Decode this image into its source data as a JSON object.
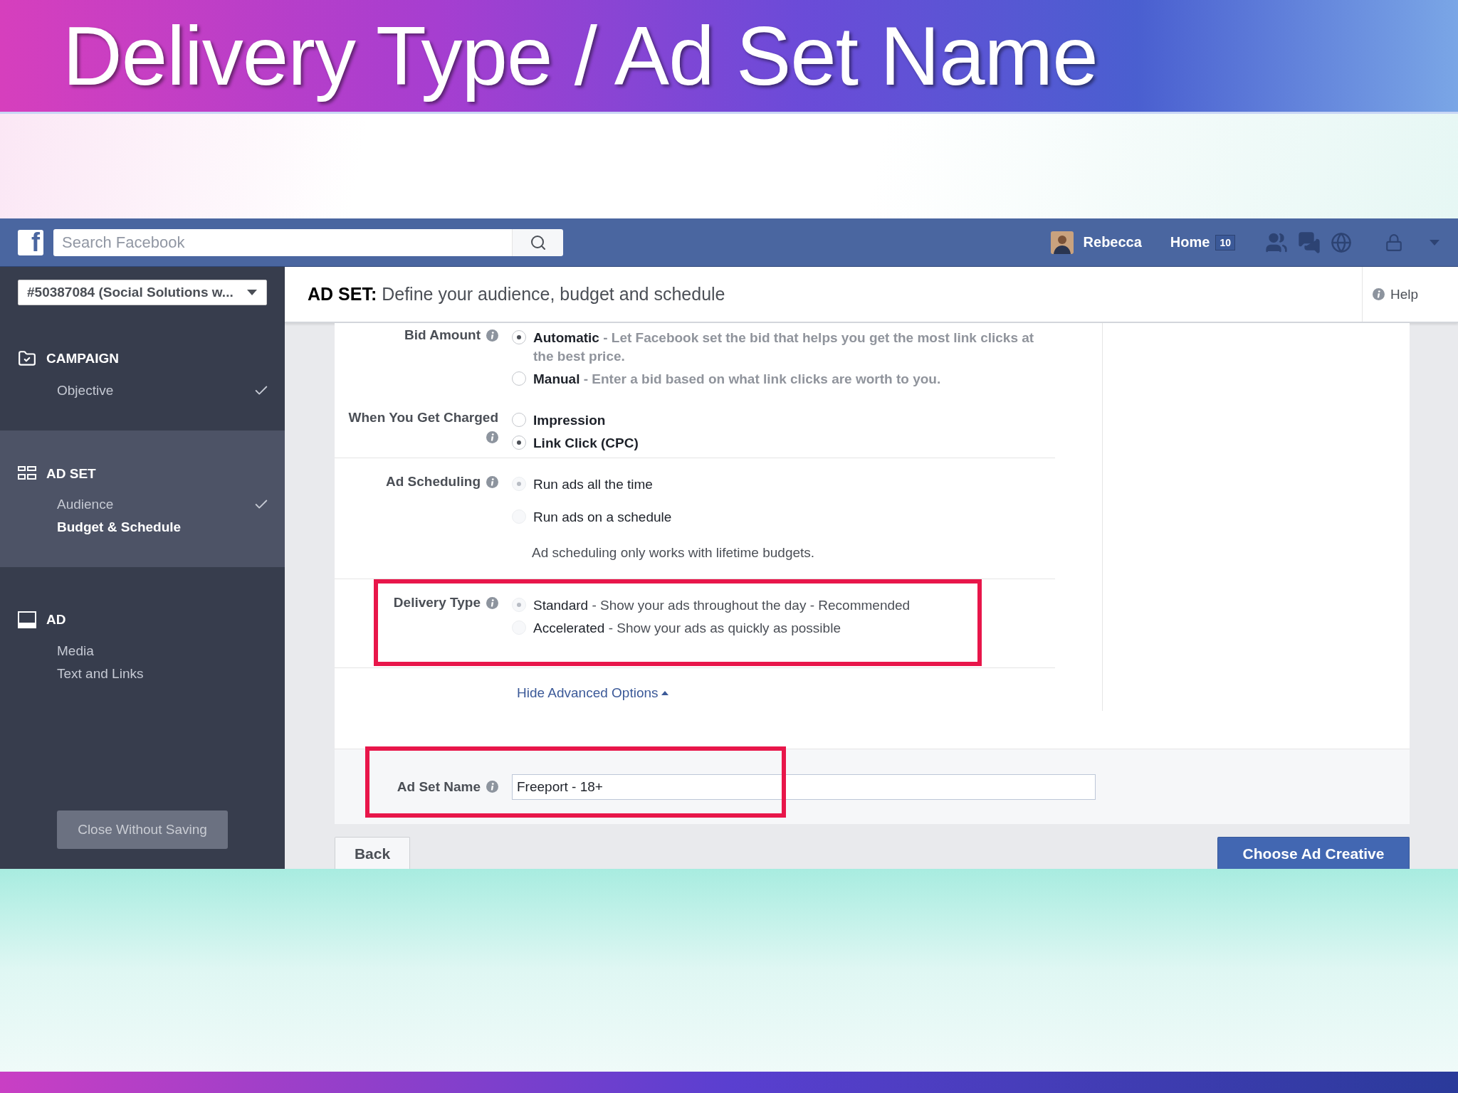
{
  "slide_title": "Delivery Type / Ad Set Name",
  "topbar": {
    "logo": "f",
    "search": {
      "placeholder": "Search Facebook"
    },
    "user_name": "Rebecca",
    "home": "Home",
    "home_count": "10"
  },
  "sidebar": {
    "account": "#50387084 (Social Solutions w...",
    "sections": [
      {
        "kind": "campaign",
        "title": "CAMPAIGN",
        "selected": false,
        "items": [
          {
            "label": "Objective",
            "selected": false,
            "done": true
          }
        ]
      },
      {
        "kind": "adset",
        "title": "AD SET",
        "selected": true,
        "items": [
          {
            "label": "Audience",
            "selected": false,
            "done": true
          },
          {
            "label": "Budget & Schedule",
            "selected": true,
            "done": false
          }
        ]
      },
      {
        "kind": "ad",
        "title": "AD",
        "selected": false,
        "items": [
          {
            "label": "Media",
            "selected": false,
            "done": false
          },
          {
            "label": "Text and Links",
            "selected": false,
            "done": false
          }
        ]
      }
    ],
    "close_button": "Close Without Saving"
  },
  "header": {
    "prefix": "AD SET:",
    "title": "Define your audience, budget and schedule",
    "help": "Help"
  },
  "form": {
    "groups": [
      {
        "kind": "bold",
        "label": "Bid Amount",
        "disabled": false,
        "highlighted": false,
        "options": [
          {
            "label": "Automatic",
            "description": "- Let Facebook set the bid that helps you get the most link clicks at the best price.",
            "selected": true
          },
          {
            "label": "Manual",
            "description": "- Enter a bid based on what link clicks are worth to you.",
            "selected": false
          }
        ]
      },
      {
        "kind": "bold",
        "label": "When You Get Charged",
        "disabled": false,
        "highlighted": false,
        "options": [
          {
            "label": "Impression",
            "selected": false
          },
          {
            "label": "Link Click (CPC)",
            "selected": true
          }
        ]
      },
      {
        "kind": "regular",
        "label": "Ad Scheduling",
        "disabled": true,
        "highlighted": false,
        "options": [
          {
            "label": "Run ads all the time",
            "selected": true
          },
          {
            "label": "Run ads on a schedule",
            "selected": false
          }
        ],
        "note": "Ad scheduling only works with lifetime budgets."
      },
      {
        "kind": "regular",
        "label": "Delivery Type",
        "disabled": true,
        "highlighted": true,
        "options": [
          {
            "label": "Standard",
            "description": "- Show your ads throughout the day - Recommended",
            "selected": true
          },
          {
            "label": "Accelerated",
            "description": "- Show your ads as quickly as possible",
            "selected": false
          }
        ]
      }
    ],
    "advanced_link": "Hide Advanced Options",
    "name_field": {
      "label": "Ad Set Name",
      "value": "Freeport - 18+",
      "highlighted": true
    }
  },
  "buttons": {
    "back": "Back",
    "next": "Choose Ad Creative"
  }
}
